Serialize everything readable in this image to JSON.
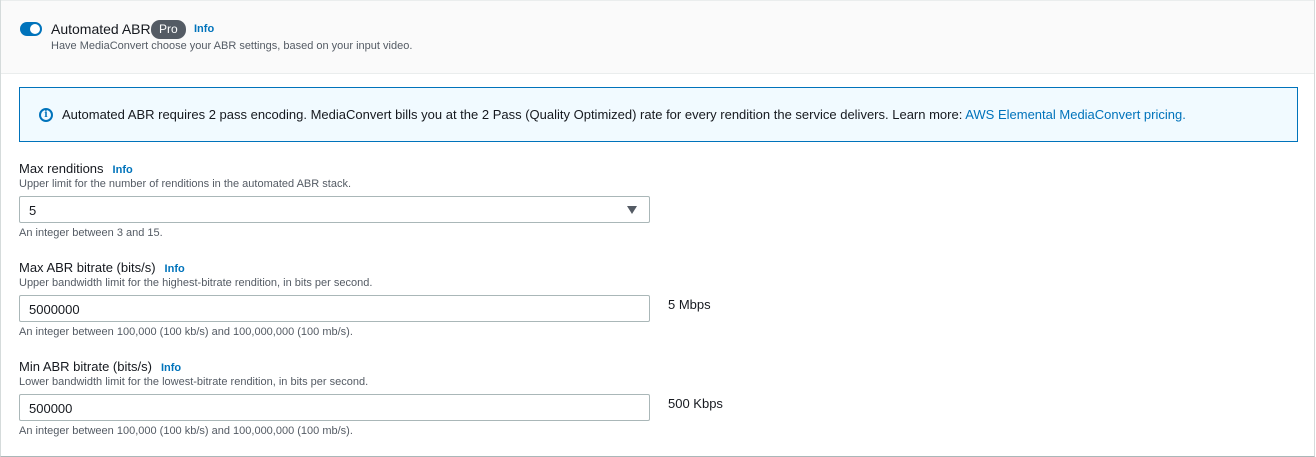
{
  "toggle": {
    "label": "Automated ABR",
    "badge": "Pro",
    "info": "Info",
    "description": "Have MediaConvert choose your ABR settings, based on your input video.",
    "on": true
  },
  "alert": {
    "text": "Automated ABR requires 2 pass encoding. MediaConvert bills you at the 2 Pass (Quality Optimized) rate for every rendition the service delivers. Learn more: ",
    "link": "AWS Elemental MediaConvert pricing."
  },
  "fields": [
    {
      "label": "Max renditions",
      "info": "Info",
      "description": "Upper limit for the number of renditions in the automated ABR stack.",
      "value": "5",
      "constraint": "An integer between 3 and 15."
    },
    {
      "label": "Max ABR bitrate (bits/s)",
      "info": "Info",
      "description": "Upper bandwidth limit for the highest-bitrate rendition, in bits per second.",
      "value": "5000000",
      "readable": "5 Mbps",
      "constraint": "An integer between 100,000 (100 kb/s) and 100,000,000 (100 mb/s)."
    },
    {
      "label": "Min ABR bitrate (bits/s)",
      "info": "Info",
      "description": "Lower bandwidth limit for the lowest-bitrate rendition, in bits per second.",
      "value": "500000",
      "readable": "500 Kbps",
      "constraint": "An integer between 100,000 (100 kb/s) and 100,000,000 (100 mb/s)."
    }
  ]
}
